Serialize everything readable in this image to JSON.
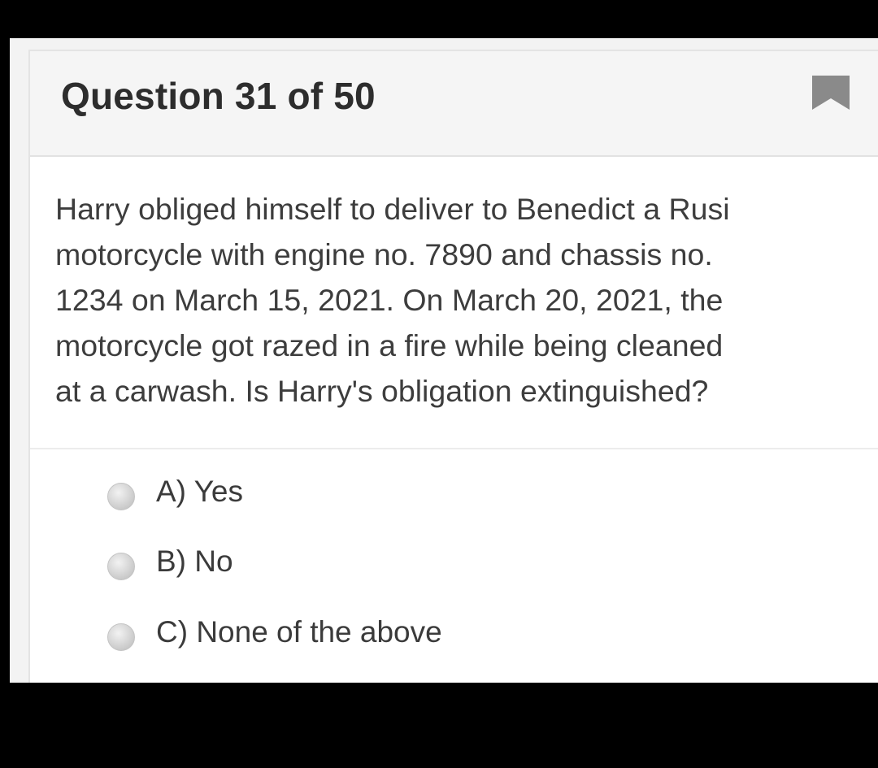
{
  "question": {
    "header": "Question 31 of 50",
    "bookmark_icon": "bookmark-icon",
    "text_lines": [
      "Harry obliged himself to deliver to Benedict a Rusi",
      "motorcycle with engine no. 7890 and chassis no.",
      "1234 on March 15, 2021. On March 20, 2021, the",
      "motorcycle got razed in a fire while being cleaned",
      "at a carwash. Is Harry's obligation extinguished?"
    ]
  },
  "options": [
    {
      "label": "A) Yes",
      "selected": false
    },
    {
      "label": "B) No",
      "selected": false
    },
    {
      "label": "C) None of the above",
      "selected": false
    }
  ],
  "colors": {
    "header_bg": "#f5f5f5",
    "card_bg": "#ffffff",
    "text": "#3d3d3d",
    "bookmark": "#8a8a8a",
    "frame": "#000000"
  }
}
